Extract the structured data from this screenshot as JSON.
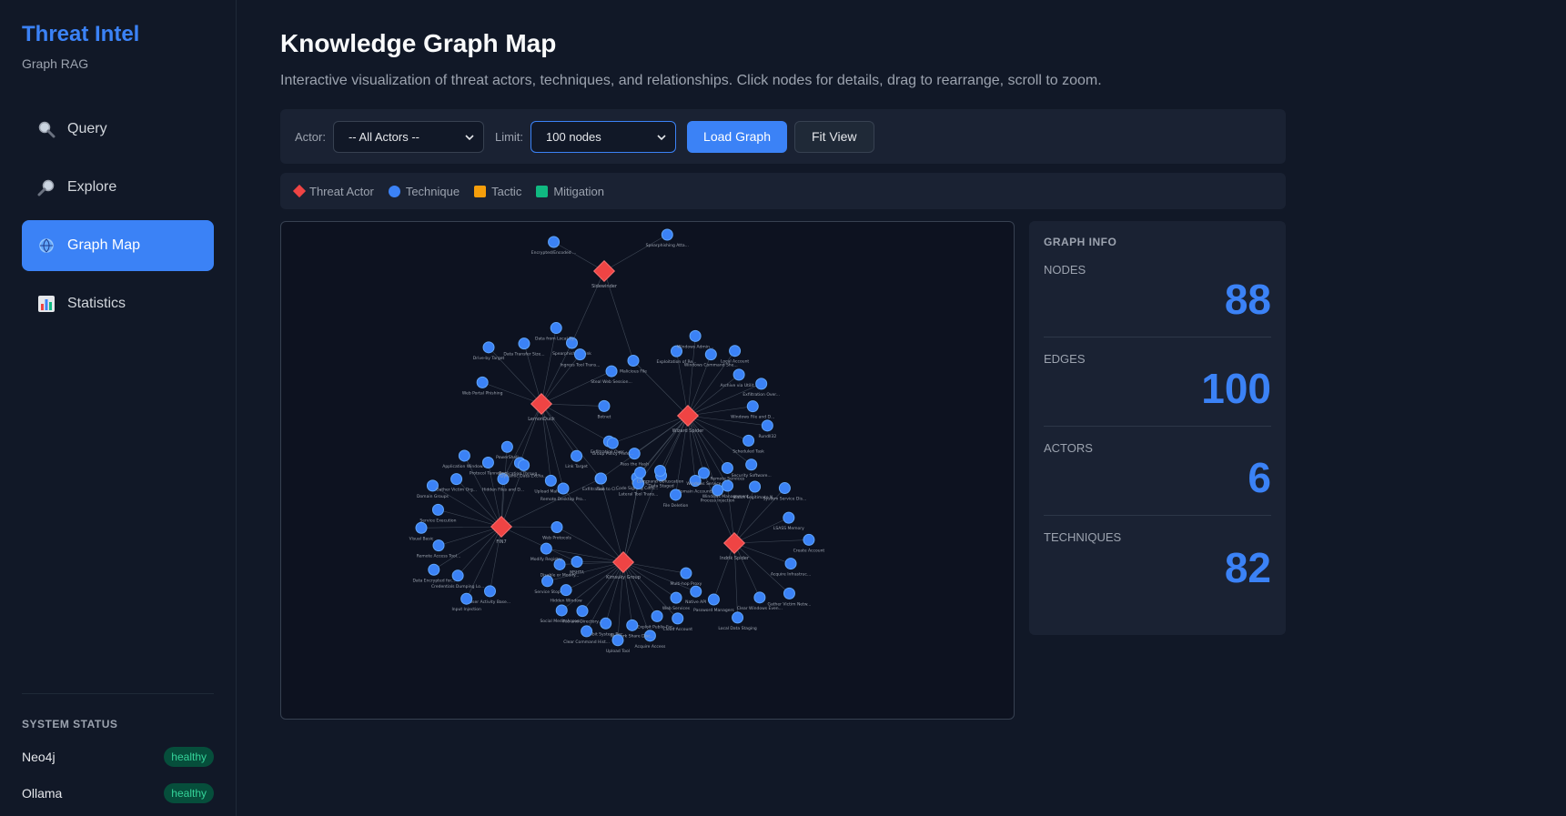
{
  "sidebar": {
    "title": "Threat Intel",
    "subtitle": "Graph RAG",
    "nav": [
      {
        "label": "Query",
        "icon": "magnifier-icon"
      },
      {
        "label": "Explore",
        "icon": "magnifier-right-icon"
      },
      {
        "label": "Graph Map",
        "icon": "globe-icon"
      },
      {
        "label": "Statistics",
        "icon": "bar-chart-icon"
      }
    ],
    "status": {
      "title": "SYSTEM STATUS",
      "items": [
        {
          "name": "Neo4j",
          "state": "healthy"
        },
        {
          "name": "Ollama",
          "state": "healthy"
        }
      ]
    }
  },
  "main": {
    "title": "Knowledge Graph Map",
    "description": "Interactive visualization of threat actors, techniques, and relationships. Click nodes for details, drag to rearrange, scroll to zoom.",
    "toolbar": {
      "actor_label": "Actor:",
      "actor_value": "-- All Actors --",
      "limit_label": "Limit:",
      "limit_value": "100 nodes",
      "load_label": "Load Graph",
      "fit_label": "Fit View"
    },
    "legend": [
      {
        "label": "Threat Actor",
        "color": "#ef4444",
        "shape": "diamond"
      },
      {
        "label": "Technique",
        "color": "#3b82f6",
        "shape": "circle"
      },
      {
        "label": "Tactic",
        "color": "#f59e0b",
        "shape": "square"
      },
      {
        "label": "Mitigation",
        "color": "#10b981",
        "shape": "square"
      }
    ],
    "info": {
      "title": "GRAPH INFO",
      "stats": [
        {
          "label": "NODES",
          "value": "88"
        },
        {
          "label": "EDGES",
          "value": "100"
        },
        {
          "label": "ACTORS",
          "value": "6"
        },
        {
          "label": "TECHNIQUES",
          "value": "82"
        }
      ]
    }
  },
  "graph": {
    "actors": [
      {
        "id": "sidewinder",
        "label": "Sidewinder"
      },
      {
        "id": "lemonduck",
        "label": "LemonDuck"
      },
      {
        "id": "wizard",
        "label": "Wizard Spider"
      },
      {
        "id": "fin7",
        "label": "FIN7"
      },
      {
        "id": "indrik",
        "label": "Indrik Spider"
      },
      {
        "id": "kimsuky",
        "label": "Kimsuky Group"
      }
    ],
    "techniques": [
      {
        "label": "Encrypted/Encoded ...",
        "actors": [
          "sidewinder"
        ]
      },
      {
        "label": "Spearphishing Atta...",
        "actors": [
          "sidewinder"
        ]
      },
      {
        "label": "Spearphishing Link",
        "actors": [
          "lemonduck",
          "sidewinder"
        ]
      },
      {
        "label": "Malicious File",
        "actors": [
          "wizard",
          "sidewinder"
        ]
      },
      {
        "label": "Web Portal Phishing",
        "actors": [
          "lemonduck"
        ]
      },
      {
        "label": "Drive-by Target",
        "actors": [
          "lemonduck"
        ]
      },
      {
        "label": "Data Transfer Size...",
        "actors": [
          "lemonduck"
        ]
      },
      {
        "label": "Data from Local Sy...",
        "actors": [
          "lemonduck"
        ]
      },
      {
        "label": "Ingress Tool Trans...",
        "actors": [
          "lemonduck"
        ]
      },
      {
        "label": "Steal Web Session...",
        "actors": [
          "lemonduck"
        ]
      },
      {
        "label": "Botnet",
        "actors": [
          "lemonduck"
        ]
      },
      {
        "label": "Exfiltration Over...",
        "actors": [
          "lemonduck"
        ]
      },
      {
        "label": "Link Target",
        "actors": [
          "lemonduck"
        ]
      },
      {
        "label": "Upload Malware",
        "actors": [
          "lemonduck"
        ]
      },
      {
        "label": "Replication Throug...",
        "actors": [
          "lemonduck"
        ]
      },
      {
        "label": "Hidden Files and D...",
        "actors": [
          "lemonduck",
          "fin7"
        ]
      },
      {
        "label": "Exploitation of Re...",
        "actors": [
          "wizard"
        ]
      },
      {
        "label": "Windows Admin...",
        "actors": [
          "wizard"
        ]
      },
      {
        "label": "Windows Command She...",
        "actors": [
          "wizard"
        ]
      },
      {
        "label": "Local Account",
        "actors": [
          "wizard"
        ]
      },
      {
        "label": "Archive via Utilit...",
        "actors": [
          "wizard"
        ]
      },
      {
        "label": "Exfiltration Over...",
        "actors": [
          "wizard"
        ]
      },
      {
        "label": "Windows File and D...",
        "actors": [
          "wizard"
        ]
      },
      {
        "label": "Rundll32",
        "actors": [
          "wizard"
        ]
      },
      {
        "label": "Scheduled Task",
        "actors": [
          "wizard"
        ]
      },
      {
        "label": "Security Software...",
        "actors": [
          "wizard"
        ]
      },
      {
        "label": "Remote Services",
        "actors": [
          "wizard"
        ]
      },
      {
        "label": "Process Injection",
        "actors": [
          "wizard"
        ]
      },
      {
        "label": "Domain Accounts",
        "actors": [
          "wizard"
        ]
      },
      {
        "label": "File Deletion",
        "actors": [
          "wizard"
        ]
      },
      {
        "label": "Data Staged",
        "actors": [
          "wizard"
        ]
      },
      {
        "label": "Code Signing Certi...",
        "actors": [
          "wizard"
        ]
      },
      {
        "label": "Pass the Hash",
        "actors": [
          "wizard"
        ]
      },
      {
        "label": "Group Policy Prefe...",
        "actors": [
          "wizard"
        ]
      },
      {
        "label": "Malware",
        "actors": [
          "wizard",
          "kimsuky"
        ]
      },
      {
        "label": "Tool",
        "actors": [
          "lemonduck",
          "kimsuky"
        ]
      },
      {
        "label": "Exfiltration to Cl...",
        "actors": [
          "fin7",
          "wizard"
        ]
      },
      {
        "label": "Web Protocols",
        "actors": [
          "fin7",
          "kimsuky"
        ]
      },
      {
        "label": "Lateral Tool Trans...",
        "actors": [
          "wizard",
          "kimsuky"
        ]
      },
      {
        "label": "Windows Management...",
        "actors": [
          "wizard",
          "indrik"
        ]
      },
      {
        "label": "Command Obfuscation",
        "actors": [
          "wizard",
          "kimsuky"
        ]
      },
      {
        "label": "Windows Service",
        "actors": [
          "wizard",
          "indrik"
        ]
      },
      {
        "label": "Remote Desktop Pro...",
        "actors": [
          "kimsuky",
          "lemonduck"
        ]
      },
      {
        "label": "MSHTA",
        "actors": [
          "kimsuky",
          "fin7"
        ]
      },
      {
        "label": "User Activity Base...",
        "actors": [
          "fin7"
        ]
      },
      {
        "label": "Input Injection",
        "actors": [
          "fin7"
        ]
      },
      {
        "label": "Credentials Dumping Lo...",
        "actors": [
          "fin7"
        ]
      },
      {
        "label": "Data Encrypted for...",
        "actors": [
          "fin7"
        ]
      },
      {
        "label": "Remote Access Tool...",
        "actors": [
          "fin7"
        ]
      },
      {
        "label": "Visual Basic",
        "actors": [
          "fin7"
        ]
      },
      {
        "label": "Service Execution",
        "actors": [
          "fin7"
        ]
      },
      {
        "label": "Domain Groups",
        "actors": [
          "fin7"
        ]
      },
      {
        "label": "Gather Victim Org...",
        "actors": [
          "fin7"
        ]
      },
      {
        "label": "Application Window...",
        "actors": [
          "fin7"
        ]
      },
      {
        "label": "Protocol Tunneling",
        "actors": [
          "fin7"
        ]
      },
      {
        "label": "PowerShell",
        "actors": [
          "fin7"
        ]
      },
      {
        "label": "Dynamic Data Excha...",
        "actors": [
          "fin7"
        ]
      },
      {
        "label": "Multi-hop Proxy",
        "actors": [
          "kimsuky"
        ]
      },
      {
        "label": "Native API",
        "actors": [
          "kimsuky"
        ]
      },
      {
        "label": "Web Services",
        "actors": [
          "kimsuky"
        ]
      },
      {
        "label": "Cloud Account",
        "actors": [
          "kimsuky"
        ]
      },
      {
        "label": "Exploit Public-Fac...",
        "actors": [
          "kimsuky"
        ]
      },
      {
        "label": "Acquire Access",
        "actors": [
          "kimsuky"
        ]
      },
      {
        "label": "Network Share Disc...",
        "actors": [
          "kimsuky"
        ]
      },
      {
        "label": "Upload Tool",
        "actors": [
          "kimsuky"
        ]
      },
      {
        "label": "Inhibit System Rec...",
        "actors": [
          "kimsuky"
        ]
      },
      {
        "label": "Clear Command Hist...",
        "actors": [
          "kimsuky"
        ]
      },
      {
        "label": "File and Directory...",
        "actors": [
          "kimsuky"
        ]
      },
      {
        "label": "Social Media Accou...",
        "actors": [
          "kimsuky"
        ]
      },
      {
        "label": "Hidden Window",
        "actors": [
          "kimsuky"
        ]
      },
      {
        "label": "Service Stop",
        "actors": [
          "kimsuky"
        ]
      },
      {
        "label": "Disable or Modify...",
        "actors": [
          "kimsuky"
        ]
      },
      {
        "label": "Modify Registry",
        "actors": [
          "kimsuky"
        ]
      },
      {
        "label": "Match Legitimate N...",
        "actors": [
          "indrik"
        ]
      },
      {
        "label": "System Service Dis...",
        "actors": [
          "indrik"
        ]
      },
      {
        "label": "LSASS Memory",
        "actors": [
          "indrik"
        ]
      },
      {
        "label": "Create Account",
        "actors": [
          "indrik"
        ]
      },
      {
        "label": "Acquire Infrastruc...",
        "actors": [
          "indrik"
        ]
      },
      {
        "label": "Gather Victim Netw...",
        "actors": [
          "indrik"
        ]
      },
      {
        "label": "Clear Windows Even...",
        "actors": [
          "indrik"
        ]
      },
      {
        "label": "Local Data Staging",
        "actors": [
          "indrik"
        ]
      },
      {
        "label": "Password Managers",
        "actors": [
          "indrik"
        ]
      }
    ]
  }
}
